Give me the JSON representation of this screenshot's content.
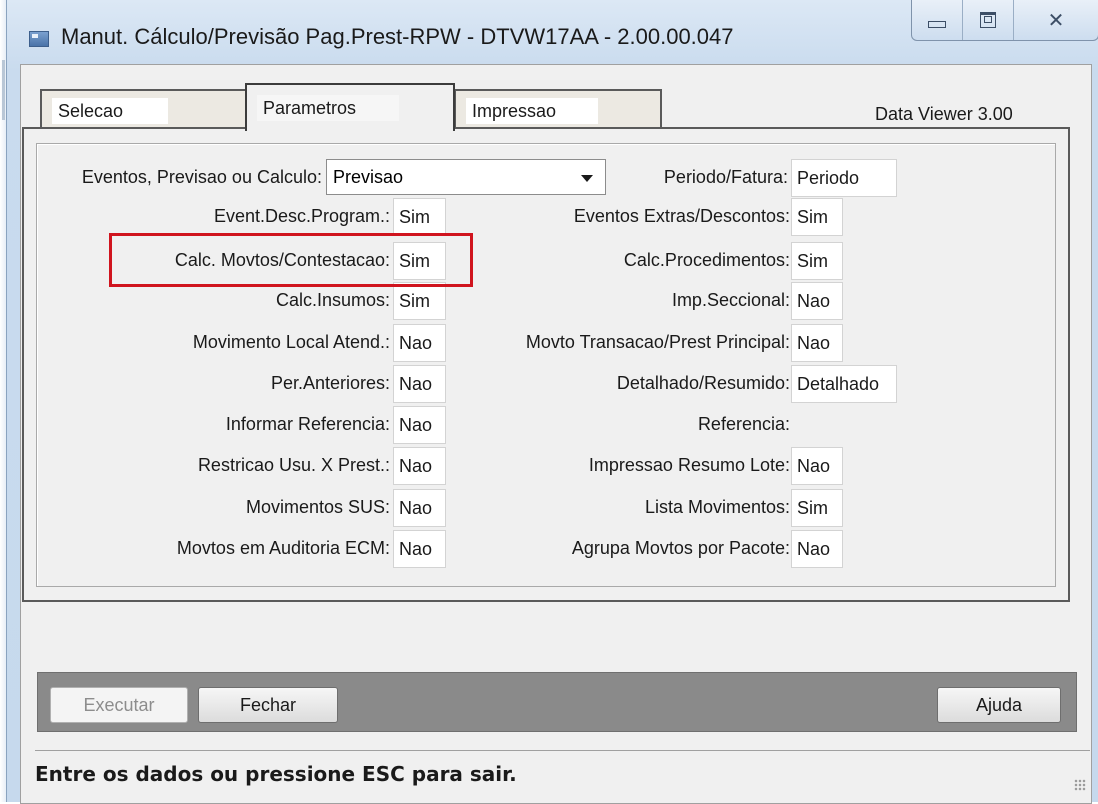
{
  "window": {
    "title": "Manut. Cálculo/Previsão Pag.Prest-RPW - DTVW17AA - 2.00.00.047",
    "minimize_label": "",
    "maximize_label": "",
    "close_label": "✕"
  },
  "tabs": [
    {
      "label": "Selecao",
      "active": false
    },
    {
      "label": "Parametros",
      "active": true
    },
    {
      "label": "Impressao",
      "active": false
    }
  ],
  "version": "Data Viewer 3.00",
  "combo": {
    "label": "Eventos, Previsao ou Calculo:",
    "value": "Previsao"
  },
  "periodo": {
    "label": "Periodo/Fatura:",
    "value": "Periodo"
  },
  "left_fields": [
    {
      "label": "Event.Desc.Program.:",
      "value": "Sim"
    },
    {
      "label": "Calc. Movtos/Contestacao:",
      "value": "Sim"
    },
    {
      "label": "Calc.Insumos:",
      "value": "Sim"
    },
    {
      "label": "Movimento Local Atend.:",
      "value": "Nao"
    },
    {
      "label": "Per.Anteriores:",
      "value": "Nao"
    },
    {
      "label": "Informar Referencia:",
      "value": "Nao"
    },
    {
      "label": "Restricao Usu. X Prest.:",
      "value": "Nao"
    },
    {
      "label": "Movimentos SUS:",
      "value": "Nao"
    },
    {
      "label": "Movtos em Auditoria ECM:",
      "value": "Nao"
    }
  ],
  "right_fields": [
    {
      "label": "Eventos Extras/Descontos:",
      "value": "Sim"
    },
    {
      "label": "Calc.Procedimentos:",
      "value": "Sim"
    },
    {
      "label": "Imp.Seccional:",
      "value": "Nao"
    },
    {
      "label": "Movto Transacao/Prest Principal:",
      "value": "Nao"
    },
    {
      "label": "Detalhado/Resumido:",
      "value": "Detalhado"
    },
    {
      "label": "Referencia:",
      "value": ""
    },
    {
      "label": "Impressao Resumo Lote:",
      "value": "Nao"
    },
    {
      "label": "Lista Movimentos:",
      "value": "Sim"
    },
    {
      "label": "Agrupa Movtos por Pacote:",
      "value": "Nao"
    }
  ],
  "buttons": {
    "executar": "Executar",
    "fechar": "Fechar",
    "ajuda": "Ajuda"
  },
  "status_text": "Entre os dados ou pressione ESC para sair.",
  "colors": {
    "highlight": "#d0141e"
  }
}
